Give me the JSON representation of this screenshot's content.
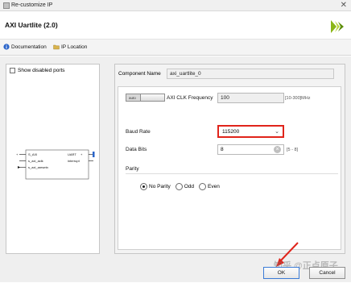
{
  "window": {
    "title": "Re-customize IP",
    "close_glyph": "✕"
  },
  "header": {
    "ip_title": "AXI Uartlite (2.0)",
    "logo_icon": "vivado-logo-icon"
  },
  "toolbar": {
    "documentation": "Documentation",
    "ip_location": "IP Location"
  },
  "left": {
    "show_disabled_ports": "Show disabled ports",
    "show_disabled_checked": false,
    "symbol": {
      "ports_left": [
        "S_AXI",
        "s_axi_aclk",
        "s_axi_aresetn"
      ],
      "ports_right": [
        "UART",
        "interrupt"
      ]
    }
  },
  "right": {
    "component_name_label": "Component Name",
    "component_name_value": "axi_uartlite_0",
    "auto_label": "auto",
    "clk_label": "AXI CLK Frequency",
    "clk_value": "100",
    "clk_range": "[10-300]MHz",
    "baud_label": "Baud Rate",
    "baud_value": "115200",
    "data_bits_label": "Data Bits",
    "data_bits_value": "8",
    "data_bits_range": "[5 - 8]",
    "parity_label": "Parity",
    "parity_options": [
      "No Parity",
      "Odd",
      "Even"
    ],
    "parity_selected": "No Parity"
  },
  "buttons": {
    "ok": "OK",
    "cancel": "Cancel"
  },
  "watermark": "知乎 @正点原子",
  "colors": {
    "highlight": "#e0241b",
    "ok_border": "#3b7bd6"
  }
}
